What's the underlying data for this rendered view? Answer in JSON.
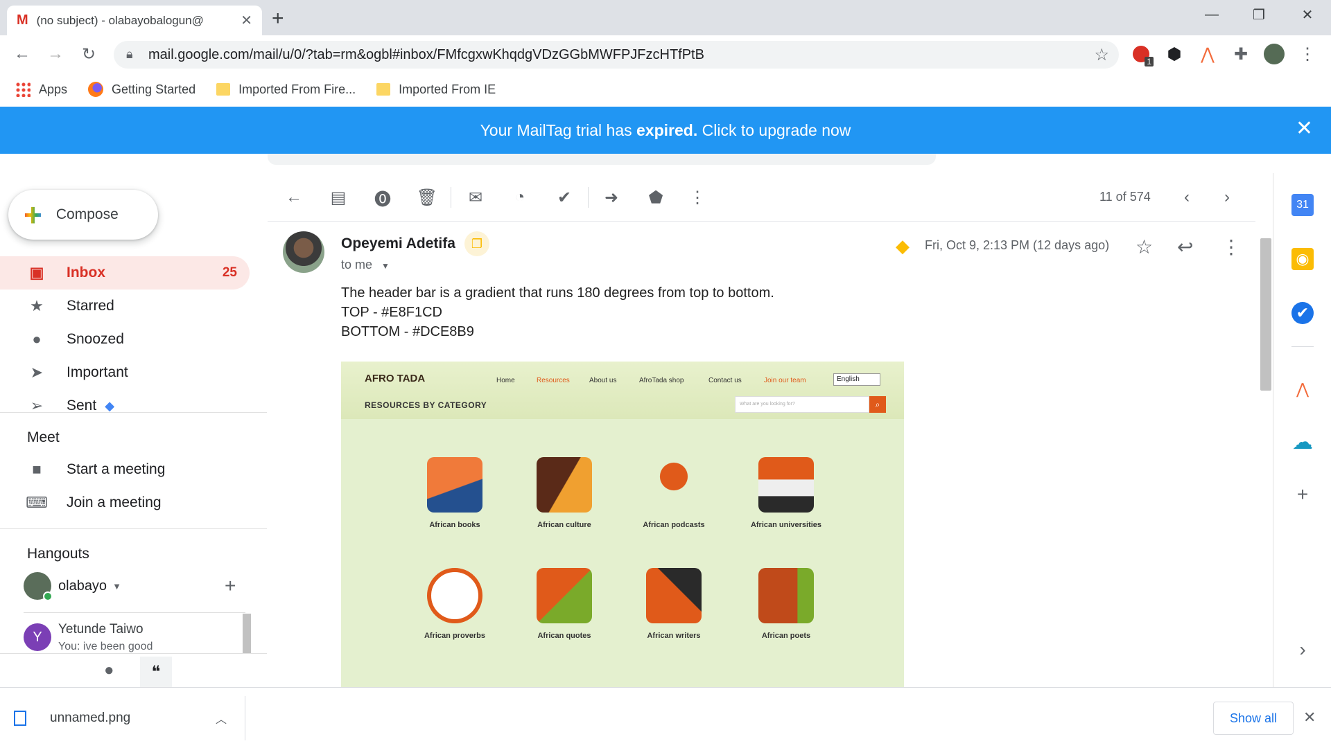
{
  "browser": {
    "tab_title": "(no subject) - olabayobalogun@",
    "new_tab_label": "+",
    "url": "mail.google.com/mail/u/0/?tab=rm&ogbl#inbox/FMfcgxwKhqdgVDzGGbMWFPJFzcHTfPtB",
    "extension_badge": "1",
    "bookmarks": [
      "Apps",
      "Getting Started",
      "Imported From Fire...",
      "Imported From IE"
    ]
  },
  "banner": {
    "prefix": "Your MailTag trial has ",
    "bold": "expired.",
    "suffix": " Click to upgrade now"
  },
  "nav": {
    "compose": "Compose",
    "items": [
      {
        "label": "Inbox",
        "count": "25"
      },
      {
        "label": "Starred"
      },
      {
        "label": "Snoozed"
      },
      {
        "label": "Important"
      },
      {
        "label": "Sent"
      }
    ],
    "meet_title": "Meet",
    "meet_items": [
      "Start a meeting",
      "Join a meeting"
    ],
    "hangouts_title": "Hangouts",
    "hangouts_user": "olabayo",
    "contact_initial": "Y",
    "contact_name": "Yetunde Taiwo",
    "contact_preview": "You: ive been good"
  },
  "message": {
    "page_count": "11 of 574",
    "sender": "Opeyemi Adetifa",
    "to": "to me",
    "date": "Fri, Oct 9, 2:13 PM (12 days ago)",
    "body": [
      "The header bar is a gradient that runs 180 degrees from top to bottom.",
      "TOP - #E8F1CD",
      "BOTTOM - #DCE8B9"
    ]
  },
  "embedded_image": {
    "logo": "AFRO TADA",
    "nav": [
      "Home",
      "Resources",
      "About us",
      "AfroTada shop",
      "Contact us",
      "Join our team"
    ],
    "language": "English",
    "section_title": "RESOURCES BY CATEGORY",
    "search_placeholder": "What are you looking for?",
    "categories": [
      "African books",
      "African culture",
      "African podcasts",
      "African universities",
      "African proverbs",
      "African quotes",
      "African writers",
      "African poets"
    ]
  },
  "downloads": {
    "filename": "unnamed.png",
    "show_all": "Show all"
  },
  "colors": {
    "banner": "#2196f3",
    "inbox_active": "#d93025",
    "header_top": "#E8F1CD",
    "header_bottom": "#DCE8B9"
  }
}
